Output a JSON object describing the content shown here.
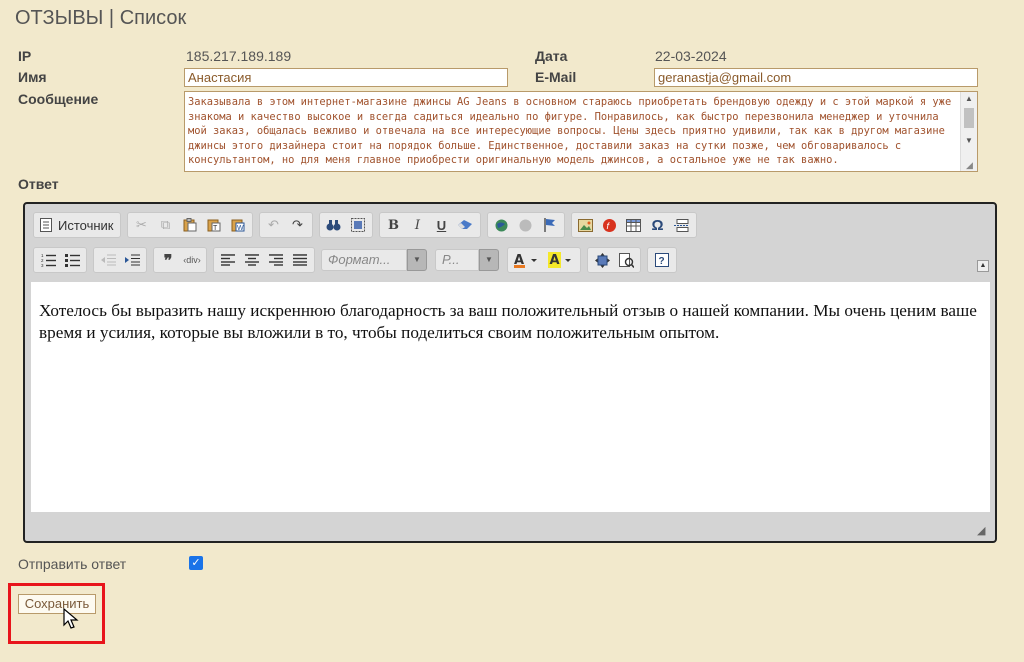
{
  "page": {
    "title": "ОТЗЫВЫ | Список"
  },
  "meta": {
    "ip_label": "IP",
    "ip_value": "185.217.189.189",
    "date_label": "Дата",
    "date_value": "22-03-2024",
    "name_label": "Имя",
    "name_value": "Анастасия",
    "email_label": "E-Mail",
    "email_value": "geranastja@gmail.com",
    "message_label": "Сообщение",
    "message_value": "Заказывала в этом интернет-магазине джинсы AG Jeans в основном стараюсь приобретать брендовую одежду и с этой маркой я уже знакома и качество высокое и всегда садиться идеально по фигуре. Понравилось, как быстро перезвонила менеджер и уточнила мой заказ, общалась вежливо и отвечала на все интересующие вопросы. Цены здесь приятно удивили, так как в другом магазине джинсы этого дизайнера стоит на порядок больше. Единственное, доставили заказ на сутки позже, чем обговаривалось с консультантом, но для меня главное приобрести оригинальную модель джинсов, а остальное уже не так важно."
  },
  "reply": {
    "label": "Ответ",
    "source_label": "Источник",
    "format_placeholder": "Формат...",
    "size_placeholder": "Р...",
    "content": "Хотелось бы выразить нашу искреннюю благодарность за ваш положительный отзыв о нашей компании. Мы очень ценим ваше время и усилия, которые вы вложили в то, чтобы поделиться своим положительным опытом."
  },
  "send": {
    "label": "Отправить ответ",
    "checked": true
  },
  "save_button": "Сохранить",
  "colors": {
    "background": "#f2e9cc",
    "highlight": "#e8141b",
    "checkbox": "#1a73e8"
  }
}
